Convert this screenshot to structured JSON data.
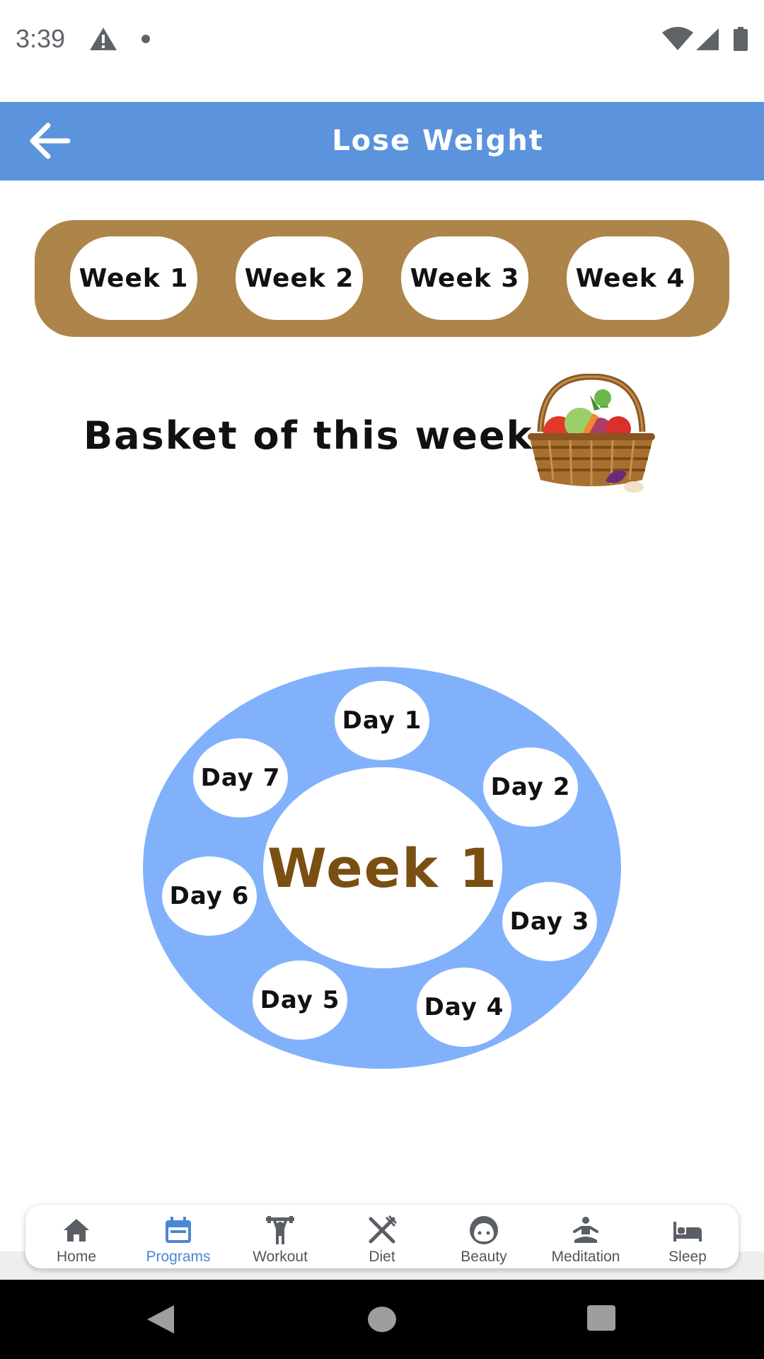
{
  "status_bar": {
    "time": "3:39"
  },
  "app_bar": {
    "title": "Lose Weight"
  },
  "weeks": [
    {
      "label": "Week 1"
    },
    {
      "label": "Week 2"
    },
    {
      "label": "Week 3"
    },
    {
      "label": "Week 4"
    }
  ],
  "basket": {
    "title": "Basket of this week",
    "image_icon": "vegetable-basket"
  },
  "week_wheel": {
    "center_label": "Week 1",
    "days": [
      "Day 1",
      "Day 2",
      "Day 3",
      "Day 4",
      "Day 5",
      "Day 6",
      "Day 7"
    ]
  },
  "bottom_nav": {
    "active": "Programs",
    "items": [
      {
        "label": "Home",
        "icon": "home-icon"
      },
      {
        "label": "Programs",
        "icon": "calendar-icon"
      },
      {
        "label": "Workout",
        "icon": "weightlifting-icon"
      },
      {
        "label": "Diet",
        "icon": "fork-knife-icon"
      },
      {
        "label": "Beauty",
        "icon": "face-icon"
      },
      {
        "label": "Meditation",
        "icon": "meditation-icon"
      },
      {
        "label": "Sleep",
        "icon": "bed-icon"
      }
    ]
  },
  "colors": {
    "app_bar": "#5b93dc",
    "week_bar": "#ad8449",
    "wheel": "#82b1fc",
    "center_text": "#7a4f12",
    "active_nav": "#4a86d6"
  }
}
